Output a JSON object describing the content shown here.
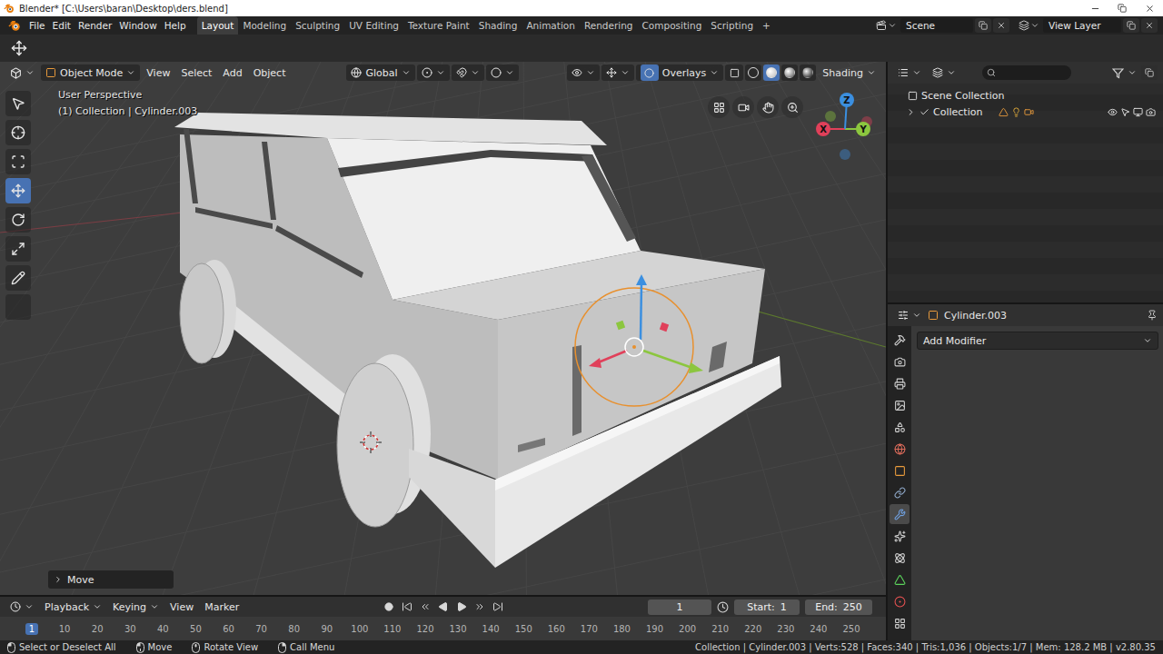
{
  "window": {
    "title": "Blender* [C:\\Users\\baran\\Desktop\\ders.blend]"
  },
  "top_bar": {
    "menus": [
      "File",
      "Edit",
      "Render",
      "Window",
      "Help"
    ],
    "workspaces": [
      {
        "label": "Layout",
        "selected": true
      },
      {
        "label": "Modeling",
        "selected": false
      },
      {
        "label": "Sculpting",
        "selected": false
      },
      {
        "label": "UV Editing",
        "selected": false
      },
      {
        "label": "Texture Paint",
        "selected": false
      },
      {
        "label": "Shading",
        "selected": false
      },
      {
        "label": "Animation",
        "selected": false
      },
      {
        "label": "Rendering",
        "selected": false
      },
      {
        "label": "Compositing",
        "selected": false
      },
      {
        "label": "Scripting",
        "selected": false
      }
    ],
    "add_workspace": "+",
    "scene": "Scene",
    "view_layer": "View Layer"
  },
  "viewport": {
    "mode": "Object Mode",
    "menus": [
      "View",
      "Select",
      "Add",
      "Object"
    ],
    "orientation": "Global",
    "overlays": {
      "label": "Overlays",
      "on": true
    },
    "xray": {
      "on": false
    },
    "shading_label": "Shading",
    "shading_modes": [
      {
        "kind": "wireframe",
        "selected": false
      },
      {
        "kind": "solid",
        "selected": true
      },
      {
        "kind": "material",
        "selected": false
      },
      {
        "kind": "rendered",
        "selected": false
      }
    ],
    "view_name": "User Perspective",
    "context": "(1) Collection | Cylinder.003",
    "tools": [
      {
        "kind": "select",
        "selected": false
      },
      {
        "kind": "cursor",
        "selected": false
      },
      {
        "kind": "transform",
        "selected": false
      },
      {
        "kind": "move",
        "selected": true
      },
      {
        "kind": "rotate",
        "selected": false
      },
      {
        "kind": "scale",
        "selected": false
      },
      {
        "kind": "annotate",
        "selected": false
      },
      {
        "kind": "measure",
        "selected": false
      }
    ],
    "gizmo_axes": [
      {
        "label": "X",
        "color": "#e0405a"
      },
      {
        "label": "Y",
        "color": "#8cc63f"
      },
      {
        "label": "Z",
        "color": "#3b8fe0"
      }
    ],
    "last_operator": {
      "label": "Move",
      "expanded": false
    }
  },
  "outliner": {
    "root": "Scene Collection",
    "collections": [
      {
        "label": "Collection",
        "expanded": false
      }
    ]
  },
  "properties": {
    "object": "Cylinder.003",
    "add_modifier": "Add Modifier",
    "tabs": [
      {
        "kind": "tool",
        "selected": false
      },
      {
        "kind": "render",
        "selected": false
      },
      {
        "kind": "output",
        "selected": false
      },
      {
        "kind": "view_layer",
        "selected": false
      },
      {
        "kind": "scene",
        "selected": false
      },
      {
        "kind": "world",
        "selected": false
      },
      {
        "kind": "object",
        "selected": false
      },
      {
        "kind": "constraints",
        "selected": false
      },
      {
        "kind": "modifiers",
        "selected": true
      },
      {
        "kind": "particles",
        "selected": false
      },
      {
        "kind": "physics",
        "selected": false
      },
      {
        "kind": "data",
        "selected": false
      },
      {
        "kind": "material",
        "selected": false
      },
      {
        "kind": "texture",
        "selected": false
      }
    ]
  },
  "timeline": {
    "menus": [
      {
        "label": "Playback",
        "kind": "dropdown"
      },
      {
        "label": "Keying",
        "kind": "dropdown"
      },
      {
        "label": "View",
        "kind": "menu"
      },
      {
        "label": "Marker",
        "kind": "menu"
      }
    ],
    "frame": "1",
    "start_label": "Start:",
    "start": "1",
    "end_label": "End:",
    "end": "250",
    "playhead": "1",
    "ticks": [
      "10",
      "20",
      "30",
      "40",
      "50",
      "60",
      "70",
      "80",
      "90",
      "100",
      "110",
      "120",
      "130",
      "140",
      "150",
      "160",
      "170",
      "180",
      "190",
      "200",
      "210",
      "220",
      "230",
      "240",
      "250"
    ]
  },
  "status_bar": {
    "hints": [
      {
        "kind": "left",
        "label": "Select or Deselect All"
      },
      {
        "kind": "drag",
        "label": "Move"
      },
      {
        "kind": "middle",
        "label": "Rotate View"
      },
      {
        "kind": "right",
        "label": "Call Menu"
      }
    ],
    "stats": "Collection | Cylinder.003 | Verts:528 | Faces:340 | Tris:1,036 | Objects:1/7 | Mem: 128.2 MB | v2.80.35"
  }
}
